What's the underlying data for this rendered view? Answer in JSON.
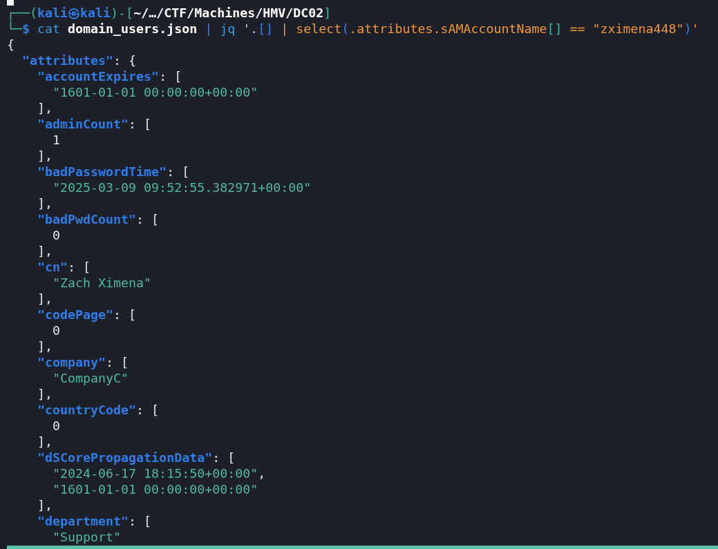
{
  "terminal": {
    "lines": [
      {
        "segments": [
          {
            "t": "┌──(",
            "kind": "frame"
          },
          {
            "t": "kali㉿kali",
            "kind": "user"
          },
          {
            "t": ")-[",
            "kind": "frame"
          },
          {
            "t": "~/…/CTF/Machines/HMV/DC02",
            "kind": "path"
          },
          {
            "t": "]",
            "kind": "frame"
          }
        ]
      },
      {
        "segments": [
          {
            "t": "└─",
            "kind": "frame"
          },
          {
            "t": "$ ",
            "kind": "user"
          },
          {
            "t": "cat ",
            "kind": "cmd"
          },
          {
            "t": "domain_users.json ",
            "kind": "arg"
          },
          {
            "t": "| ",
            "kind": "op"
          },
          {
            "t": "jq ",
            "kind": "cmd"
          },
          {
            "t": "'.",
            "kind": "plain"
          },
          {
            "t": "[]",
            "kind": "op"
          },
          {
            "t": " | select",
            "kind": "quote"
          },
          {
            "t": "(",
            "kind": "op"
          },
          {
            "t": ".attributes.sAMAccountName",
            "kind": "quote"
          },
          {
            "t": "[]",
            "kind": "frame"
          },
          {
            "t": " == \"zximena448\"",
            "kind": "quote"
          },
          {
            "t": ")",
            "kind": "op"
          },
          {
            "t": "'",
            "kind": "quote"
          }
        ]
      },
      {
        "segments": [
          {
            "t": "{",
            "kind": "punct"
          }
        ]
      },
      {
        "segments": [
          {
            "t": "  \"attributes\"",
            "kind": "key"
          },
          {
            "t": ": {",
            "kind": "punct"
          }
        ]
      },
      {
        "segments": [
          {
            "t": "    \"accountExpires\"",
            "kind": "key"
          },
          {
            "t": ": [",
            "kind": "punct"
          }
        ]
      },
      {
        "segments": [
          {
            "t": "      \"1601-01-01 00:00:00+00:00\"",
            "kind": "string"
          }
        ]
      },
      {
        "segments": [
          {
            "t": "    ],",
            "kind": "punct"
          }
        ]
      },
      {
        "segments": [
          {
            "t": "    \"adminCount\"",
            "kind": "key"
          },
          {
            "t": ": [",
            "kind": "punct"
          }
        ]
      },
      {
        "segments": [
          {
            "t": "      1",
            "kind": "number"
          }
        ]
      },
      {
        "segments": [
          {
            "t": "    ],",
            "kind": "punct"
          }
        ]
      },
      {
        "segments": [
          {
            "t": "    \"badPasswordTime\"",
            "kind": "key"
          },
          {
            "t": ": [",
            "kind": "punct"
          }
        ]
      },
      {
        "segments": [
          {
            "t": "      \"2025-03-09 09:52:55.382971+00:00\"",
            "kind": "string"
          }
        ]
      },
      {
        "segments": [
          {
            "t": "    ],",
            "kind": "punct"
          }
        ]
      },
      {
        "segments": [
          {
            "t": "    \"badPwdCount\"",
            "kind": "key"
          },
          {
            "t": ": [",
            "kind": "punct"
          }
        ]
      },
      {
        "segments": [
          {
            "t": "      0",
            "kind": "number"
          }
        ]
      },
      {
        "segments": [
          {
            "t": "    ],",
            "kind": "punct"
          }
        ]
      },
      {
        "segments": [
          {
            "t": "    \"cn\"",
            "kind": "key"
          },
          {
            "t": ": [",
            "kind": "punct"
          }
        ]
      },
      {
        "segments": [
          {
            "t": "      \"Zach Ximena\"",
            "kind": "string"
          }
        ]
      },
      {
        "segments": [
          {
            "t": "    ],",
            "kind": "punct"
          }
        ]
      },
      {
        "segments": [
          {
            "t": "    \"codePage\"",
            "kind": "key"
          },
          {
            "t": ": [",
            "kind": "punct"
          }
        ]
      },
      {
        "segments": [
          {
            "t": "      0",
            "kind": "number"
          }
        ]
      },
      {
        "segments": [
          {
            "t": "    ],",
            "kind": "punct"
          }
        ]
      },
      {
        "segments": [
          {
            "t": "    \"company\"",
            "kind": "key"
          },
          {
            "t": ": [",
            "kind": "punct"
          }
        ]
      },
      {
        "segments": [
          {
            "t": "      \"CompanyC\"",
            "kind": "string"
          }
        ]
      },
      {
        "segments": [
          {
            "t": "    ],",
            "kind": "punct"
          }
        ]
      },
      {
        "segments": [
          {
            "t": "    \"countryCode\"",
            "kind": "key"
          },
          {
            "t": ": [",
            "kind": "punct"
          }
        ]
      },
      {
        "segments": [
          {
            "t": "      0",
            "kind": "number"
          }
        ]
      },
      {
        "segments": [
          {
            "t": "    ],",
            "kind": "punct"
          }
        ]
      },
      {
        "segments": [
          {
            "t": "    \"dSCorePropagationData\"",
            "kind": "key"
          },
          {
            "t": ": [",
            "kind": "punct"
          }
        ]
      },
      {
        "segments": [
          {
            "t": "      \"2024-06-17 18:15:50+00:00\"",
            "kind": "string"
          },
          {
            "t": ",",
            "kind": "punct"
          }
        ]
      },
      {
        "segments": [
          {
            "t": "      \"1601-01-01 00:00:00+00:00\"",
            "kind": "string"
          }
        ]
      },
      {
        "segments": [
          {
            "t": "    ],",
            "kind": "punct"
          }
        ]
      },
      {
        "segments": [
          {
            "t": "    \"department\"",
            "kind": "key"
          },
          {
            "t": ": [",
            "kind": "punct"
          }
        ]
      },
      {
        "segments": [
          {
            "t": "      \"Support\"",
            "kind": "string"
          }
        ]
      }
    ]
  }
}
